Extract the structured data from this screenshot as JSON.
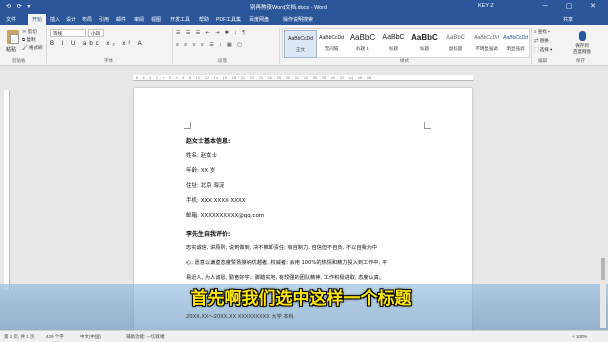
{
  "window": {
    "doc_title": "别再熬夜Word文档.docx - Word",
    "account": "KEY Z",
    "controls": "─ ▢ ✕",
    "qat": "⟲ ⟳ ▾"
  },
  "ribbon_tabs": [
    "文件",
    "开始",
    "插入",
    "设计",
    "布局",
    "引用",
    "邮件",
    "审阅",
    "视图",
    "开发工具",
    "帮助",
    "PDF工具集",
    "百度网盘",
    "操作说明搜索"
  ],
  "ribbon": {
    "paste": "粘贴",
    "cut": "✂ 剪切",
    "copy": "⧉ 复制",
    "painter": "🖌 格式刷",
    "font": "等线",
    "size": "小四",
    "fmt": "B I U abc x₂ x² A",
    "para1": "☰ ☰ ☰ ⇤ ⇥ ✱ ↕ ¶",
    "para2": "≡ ≡ ≡ ≡ ☰ ↕ ▦ ▢",
    "styles": [
      {
        "sample": "AaBbCcDd",
        "name": "正文"
      },
      {
        "sample": "AaBbCcDd",
        "name": "无间隔"
      },
      {
        "sample": "AaBbC",
        "name": "标题 1"
      },
      {
        "sample": "AaBbC",
        "name": "标题"
      },
      {
        "sample": "AaBbC",
        "name": "标题"
      },
      {
        "sample": "AaBbC",
        "name": "副标题"
      },
      {
        "sample": "AaBbCcDd",
        "name": "不明显强调"
      },
      {
        "sample": "AaBbCcDd",
        "name": "明显强调"
      }
    ],
    "find": "⌕ 查找 ▾",
    "replace": "⇄ 替换",
    "select": "⬚ 选择 ▾",
    "voice": "保存到\n百度网盘",
    "groups": [
      "剪贴板",
      "字体",
      "段落",
      "样式",
      "编辑",
      "保存"
    ]
  },
  "share": "共享",
  "document": {
    "heading1": "赵女士基本信息:",
    "name": "姓名:  赵女士",
    "age": "年龄:  XX 岁",
    "address": "住址:  北京  海淀",
    "phone": "手机:  XXX XXXX XXXX",
    "email": "邮箱:  XXXXXXXXXX@qq.com",
    "heading2": "李先生自我评价:",
    "para1": "忠实诚信, 讲原则, 说到做到, 决不推卸责任; 有自制力, 自信但不自负, 不以自我为中",
    "para2": "心; 愿意以谦虚态度赞扬接纳优越者, 权威者; 会用 100%的热情和精力投入到工作中; 平",
    "para3": "易近人, 为人诚恳, 勤奋好学、脚踏实地, 有较强的团队精神, 工作积极进取, 态度认真。",
    "cutoff": "20XX.XX～20XX.XX                    XXXXXXXXX 大学                    本科"
  },
  "status": {
    "page": "第 1 页, 共 1 页",
    "words": "429 个字",
    "lang": "中文(中国)",
    "mode": "辅助功能: 一切就绪",
    "zoom": "+ 100%"
  },
  "subtitle": "首先啊我们选中这样一个标题"
}
